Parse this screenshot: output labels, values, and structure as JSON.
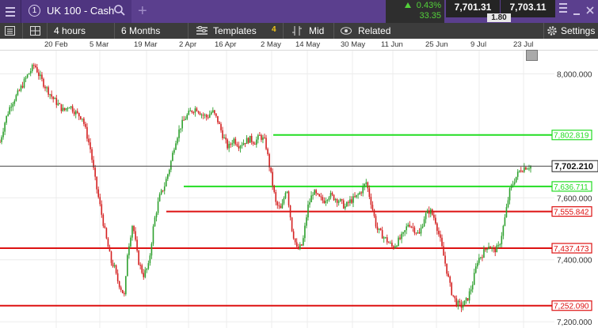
{
  "header": {
    "tab_number": "1",
    "instrument": "UK 100 - Cash",
    "change_percent": "0.43%",
    "change_points": "33.35",
    "sell_price": "7,701.31",
    "buy_price": "7,703.11",
    "spread": "1.80"
  },
  "toolbar": {
    "interval": "4 hours",
    "range": "6 Months",
    "templates_label": "Templates",
    "templates_count": "4",
    "price_type": "Mid",
    "related_label": "Related",
    "settings_label": "Settings"
  },
  "colors": {
    "topbar": "#5b3f8e",
    "toolbar": "#3c3c3c",
    "up": "#2ea02e",
    "down": "#d42020",
    "support_green": "#22dd22",
    "resistance_red": "#dd1111"
  },
  "chart_data": {
    "type": "line",
    "instrument": "UK 100 - Cash",
    "x_ticks": [
      "20 Feb",
      "5 Mar",
      "19 Mar",
      "2 Apr",
      "16 Apr",
      "2 May",
      "14 May",
      "30 May",
      "11 Jun",
      "25 Jun",
      "9 Jul",
      "23 Jul"
    ],
    "y_ticks": [
      "8,000.000",
      "7,600.000",
      "7,400.000",
      "7,200.000"
    ],
    "ylim": [
      7180,
      8075
    ],
    "current_price": "7,702.210",
    "levels": [
      {
        "value": 7802.819,
        "label": "7,802.819",
        "color": "#22dd22"
      },
      {
        "value": 7636.711,
        "label": "7,636.711",
        "color": "#22dd22"
      },
      {
        "value": 7555.842,
        "label": "7,555.842",
        "color": "#dd1111"
      },
      {
        "value": 7437.473,
        "label": "7,437.473",
        "color": "#dd1111"
      },
      {
        "value": 7252.09,
        "label": "7,252.090",
        "color": "#dd1111"
      }
    ],
    "series": [
      {
        "x": [
          0,
          0.01,
          0.02,
          0.035,
          0.05,
          0.065,
          0.075,
          0.085,
          0.1,
          0.12,
          0.13,
          0.145,
          0.155,
          0.17,
          0.18,
          0.19,
          0.2,
          0.205,
          0.21,
          0.215,
          0.22,
          0.225,
          0.23,
          0.235,
          0.24,
          0.25,
          0.255,
          0.26,
          0.27,
          0.28,
          0.285,
          0.29,
          0.3,
          0.31,
          0.32,
          0.33,
          0.34,
          0.35,
          0.36,
          0.37,
          0.38,
          0.39,
          0.4,
          0.41,
          0.42,
          0.43,
          0.44,
          0.45,
          0.46,
          0.47,
          0.48,
          0.49,
          0.5,
          0.51,
          0.52,
          0.53,
          0.54,
          0.55,
          0.56,
          0.57,
          0.58,
          0.59,
          0.6,
          0.61,
          0.62,
          0.63,
          0.64,
          0.65,
          0.66,
          0.67,
          0.68,
          0.69,
          0.7,
          0.71,
          0.72,
          0.73,
          0.74,
          0.75,
          0.76,
          0.77,
          0.78,
          0.79,
          0.8,
          0.81,
          0.82,
          0.83,
          0.84,
          0.85,
          0.86,
          0.87,
          0.88,
          0.89,
          0.9,
          0.91,
          0.92,
          0.93,
          0.94,
          0.95,
          0.96,
          0.97,
          0.98,
          0.99,
          1.0
        ],
        "values": [
          7780,
          7850,
          7900,
          7940,
          7990,
          8030,
          7990,
          7960,
          7920,
          7880,
          7900,
          7870,
          7860,
          7760,
          7650,
          7560,
          7470,
          7430,
          7390,
          7380,
          7340,
          7320,
          7300,
          7280,
          7420,
          7520,
          7460,
          7400,
          7350,
          7380,
          7450,
          7520,
          7600,
          7640,
          7700,
          7780,
          7830,
          7860,
          7880,
          7890,
          7870,
          7860,
          7880,
          7850,
          7800,
          7760,
          7790,
          7770,
          7780,
          7790,
          7780,
          7800,
          7780,
          7680,
          7580,
          7560,
          7640,
          7500,
          7430,
          7450,
          7570,
          7620,
          7600,
          7590,
          7610,
          7600,
          7590,
          7570,
          7590,
          7600,
          7620,
          7650,
          7580,
          7500,
          7480,
          7460,
          7440,
          7460,
          7480,
          7520,
          7500,
          7480,
          7540,
          7560,
          7530,
          7460,
          7380,
          7300,
          7260,
          7250,
          7270,
          7320,
          7400,
          7420,
          7450,
          7430,
          7440,
          7520,
          7620,
          7660,
          7690,
          7700,
          7702
        ]
      }
    ]
  }
}
